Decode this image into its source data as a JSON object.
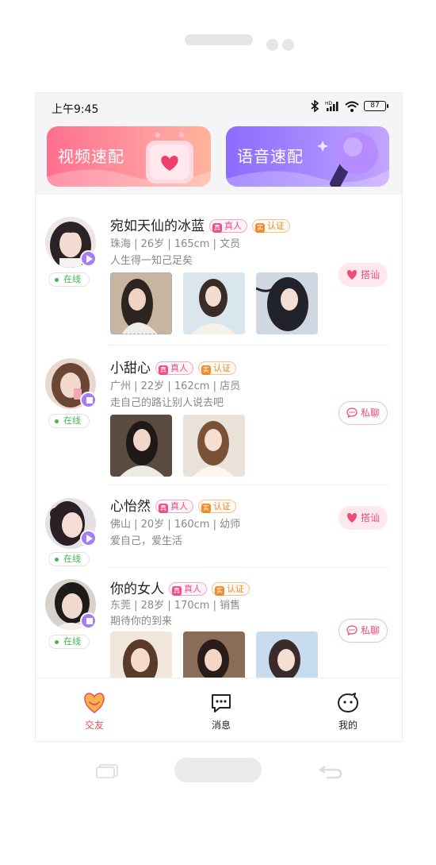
{
  "status_bar": {
    "time": "上午9:45",
    "network": "HD",
    "battery": "87"
  },
  "banners": {
    "video_match": "视频速配",
    "voice_match": "语音速配"
  },
  "badges": {
    "real": "真人",
    "real_icon": "真",
    "auth": "认证",
    "auth_icon": "实"
  },
  "online_label": "在线",
  "users": [
    {
      "name": "宛如天仙的冰蓝",
      "meta": "珠海 | 26岁 | 165cm | 文员",
      "bio": "人生得一知己足矣",
      "action": "搭讪",
      "photos": 3
    },
    {
      "name": "小甜心",
      "meta": "广州 | 22岁 | 162cm | 店员",
      "bio": "走自己的路让别人说去吧",
      "action": "私聊",
      "photos": 2
    },
    {
      "name": "心怡然",
      "meta": "佛山 | 20岁 | 160cm | 幼师",
      "bio": "爱自己，爱生活",
      "action": "搭讪",
      "photos": 0
    },
    {
      "name": "你的女人",
      "meta": "东莞 | 28岁 | 170cm | 销售",
      "bio": "期待你的到来",
      "action": "私聊",
      "photos": 3
    }
  ],
  "tabs": {
    "friends": "交友",
    "messages": "消息",
    "mine": "我的"
  },
  "colors": {
    "accent_pink": "#ee4c7a",
    "online_green": "#3cb84f",
    "voice_purple": "#8c6bff"
  }
}
